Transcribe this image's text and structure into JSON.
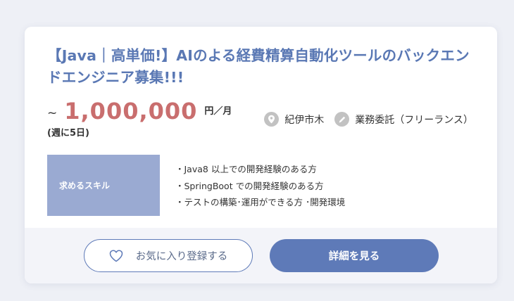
{
  "job": {
    "title": "【Java｜高単価!】AIのよる経費精算自動化ツールのバックエンドエンジニア募集!!!",
    "salary": {
      "prefix": "~",
      "amount": "1,000,000",
      "unit": "円／月",
      "note": "(週に5日)"
    },
    "location": {
      "icon": "map-pin-icon",
      "label": "紀伊市木"
    },
    "contract": {
      "icon": "pencil-icon",
      "label": "業務委託（フリーランス）"
    },
    "skills": {
      "label": "求めるスキル",
      "items": [
        "・Java8 以上での開発経験のある方",
        "・SpringBoot での開発経験のある方",
        "・テストの構築･運用ができる方 ･開発環境"
      ]
    }
  },
  "actions": {
    "favorite_label": "お気に入り登録する",
    "favorite_icon": "heart-icon",
    "detail_label": "詳細を見る"
  },
  "colors": {
    "accent": "#5e7ab8",
    "title": "#5a78b4",
    "salary": "#c96e6e",
    "skill_label_bg": "#9aaad2",
    "footer_bg": "#f3f4f9",
    "page_bg": "#eef0f6",
    "icon_bg": "#c2c2c2"
  }
}
